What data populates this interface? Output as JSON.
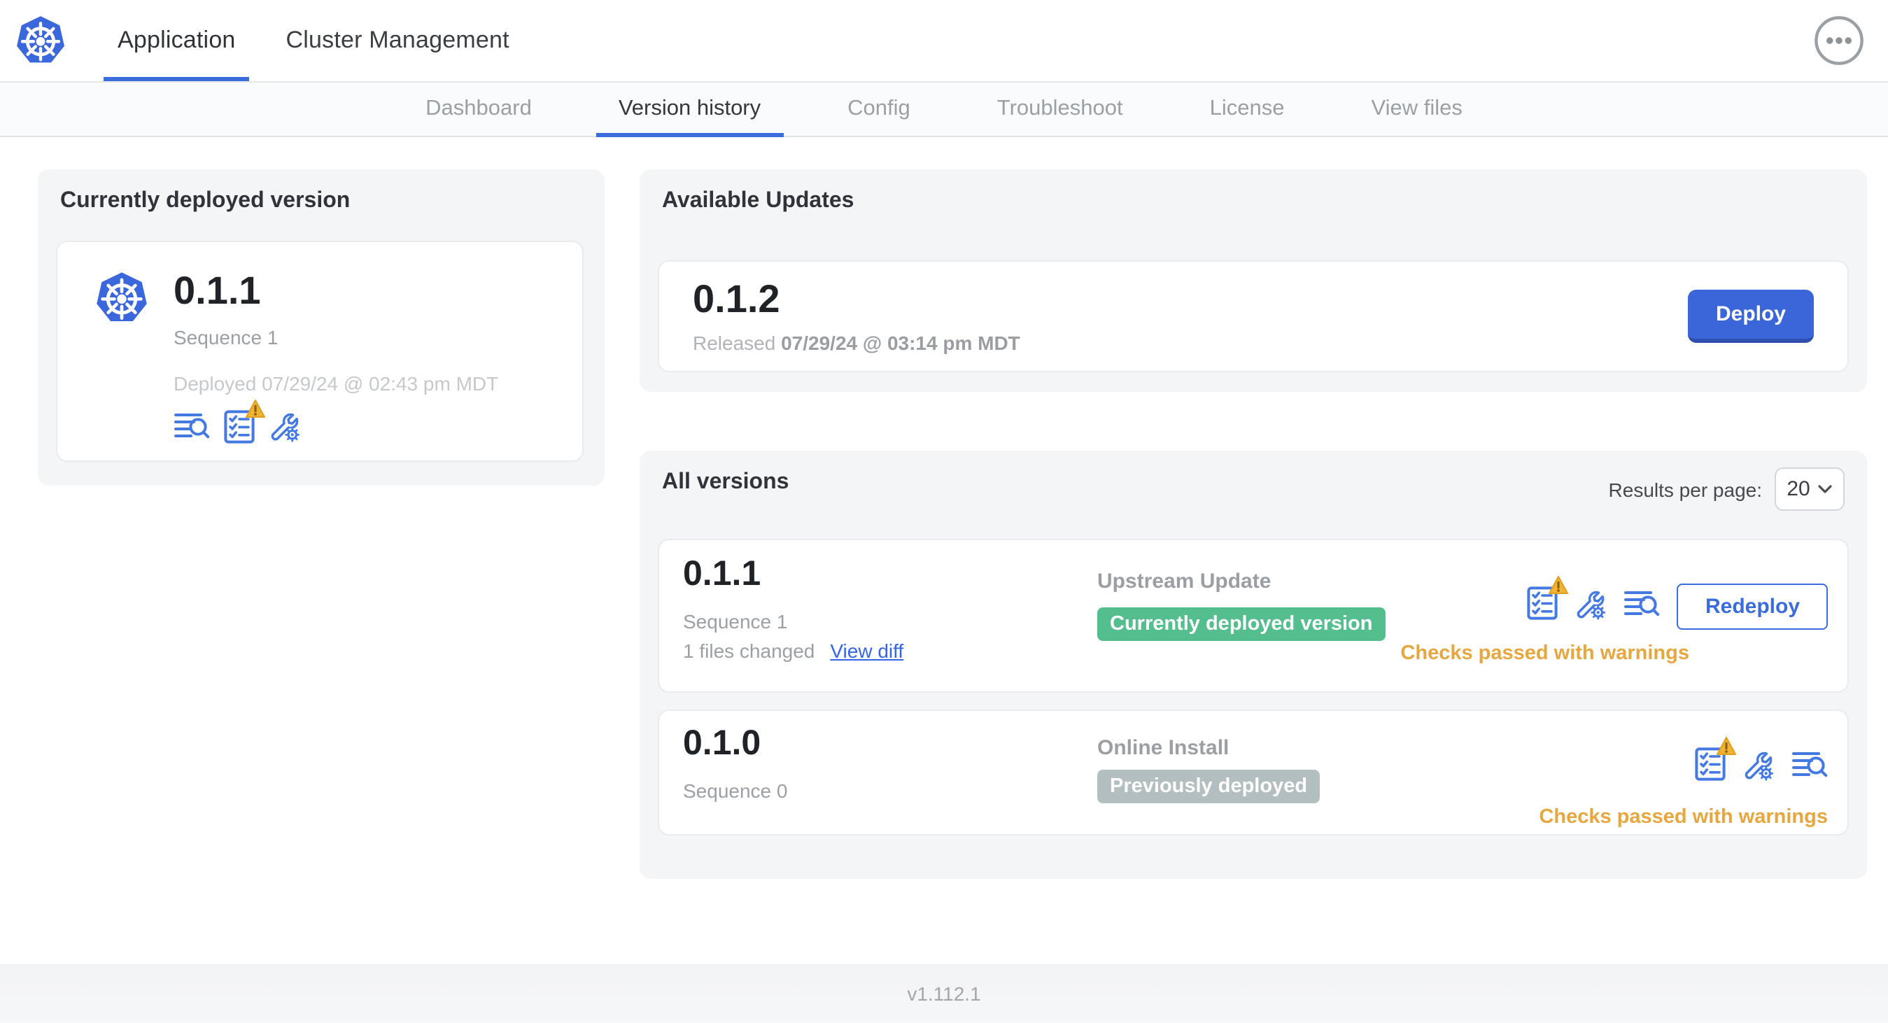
{
  "header": {
    "tabs": [
      {
        "label": "Application",
        "active": true
      },
      {
        "label": "Cluster Management",
        "active": false
      }
    ]
  },
  "subnav": {
    "tabs": [
      {
        "label": "Dashboard",
        "active": false
      },
      {
        "label": "Version history",
        "active": true
      },
      {
        "label": "Config",
        "active": false
      },
      {
        "label": "Troubleshoot",
        "active": false
      },
      {
        "label": "License",
        "active": false
      },
      {
        "label": "View files",
        "active": false
      }
    ]
  },
  "current_version": {
    "title": "Currently deployed version",
    "version": "0.1.1",
    "sequence": "Sequence 1",
    "deployed": "Deployed 07/29/24 @ 02:43 pm MDT"
  },
  "available_updates": {
    "title": "Available Updates",
    "version": "0.1.2",
    "released_prefix": "Released",
    "released_date": "07/29/24 @ 03:14 pm MDT",
    "deploy_label": "Deploy"
  },
  "all_versions": {
    "title": "All versions",
    "results_per_page_label": "Results per page:",
    "results_per_page_value": "20",
    "rows": [
      {
        "version": "0.1.1",
        "sequence": "Sequence 1",
        "files_changed": "1 files changed",
        "view_diff_label": "View diff",
        "source": "Upstream Update",
        "status_badge": "Currently deployed version",
        "badge_type": "green",
        "action_label": "Redeploy",
        "checks_status": "Checks passed with warnings"
      },
      {
        "version": "0.1.0",
        "sequence": "Sequence 0",
        "source": "Online Install",
        "status_badge": "Previously deployed",
        "badge_type": "gray",
        "checks_status": "Checks passed with warnings"
      }
    ]
  },
  "footer": {
    "app_version": "v1.112.1"
  },
  "icons": {
    "logo": "kubernetes-helm",
    "overflow_menu": "ellipsis-circle",
    "logs": "lines-magnifier",
    "preflight": "checklist",
    "preflight_warning": "warning-triangle",
    "config": "wrench-gear",
    "select_chevron": "chevron-down"
  },
  "colors": {
    "primary_blue": "#3B66D9",
    "link_blue": "#3465E6",
    "icon_blue": "#4479E4",
    "tab_underline": "#3B6CDE",
    "green_badge": "#54BE8E",
    "gray_badge": "#B3BEC0",
    "warning_orange": "#E7A73E",
    "card_gray": "#F4F5F7"
  }
}
